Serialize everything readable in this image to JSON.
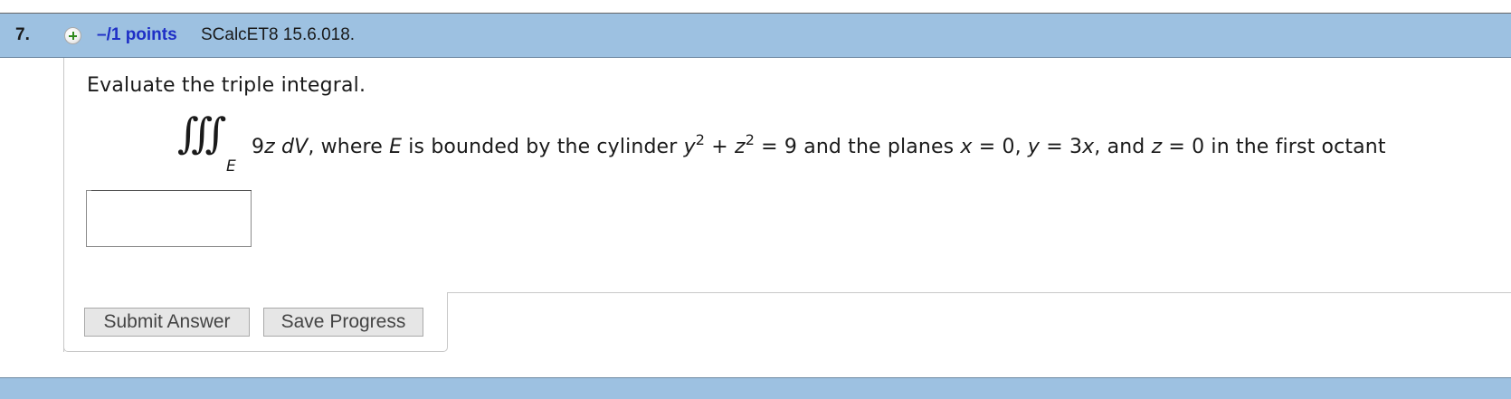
{
  "question": {
    "number": "7.",
    "points": "–/1 points",
    "id": "SCalcET8 15.6.018."
  },
  "prompt": "Evaluate the triple integral.",
  "math": {
    "integral_symbol": "∭",
    "region": "E",
    "integrand": "9z dV",
    "where_text": ", where ",
    "region_var": "E",
    "bounded_text": " is bounded by the cylinder ",
    "y_var": "y",
    "exp1": "2",
    "plus": " + ",
    "z_var": "z",
    "exp2": "2",
    "equals_9": " = 9 and the planes ",
    "x_var": "x",
    "x_eq": " = 0, ",
    "y_var2": "y",
    "y_eq": " = 3",
    "x_var2": "x",
    "and_text": ", and ",
    "z_var2": "z",
    "z_eq": " = 0 in the first octant"
  },
  "answer": {
    "value": "",
    "placeholder": ""
  },
  "buttons": {
    "submit": "Submit Answer",
    "save": "Save Progress"
  },
  "icons": {
    "expand": "plus-circle-icon"
  },
  "colors": {
    "header_bg": "#9dc1e1",
    "points_text": "#1e2fc6",
    "icon_plus": "#2f8a1c"
  }
}
